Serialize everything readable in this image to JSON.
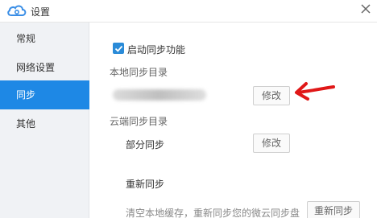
{
  "window": {
    "title": "设置",
    "logo_icon": "cloud-logo-icon",
    "close_icon": "close-icon"
  },
  "sidebar": {
    "items": [
      {
        "label": "常规"
      },
      {
        "label": "网络设置"
      },
      {
        "label": "同步"
      },
      {
        "label": "其他"
      }
    ],
    "active_index": 2
  },
  "sync": {
    "enable_label": "启动同步功能",
    "enable_checked": true,
    "local_dir_label": "本地同步目录",
    "modify_label": "修改",
    "cloud_dir_label": "云端同步目录",
    "partial_sync_label": "部分同步",
    "partial_modify_label": "修改",
    "resync_label": "重新同步",
    "resync_hint": "清空本地缓存，重新同步您的微云同步盘",
    "resync_button": "重新同步"
  },
  "colors": {
    "accent": "#1e88e5",
    "annotation_arrow": "#e01818"
  }
}
